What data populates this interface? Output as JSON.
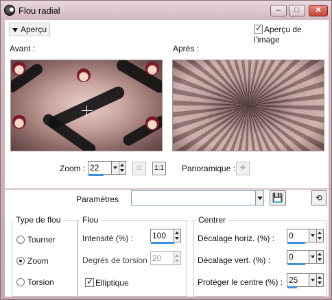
{
  "window": {
    "title": "Flou radial",
    "minimize": "–",
    "maximize": "□",
    "close": "✕"
  },
  "top": {
    "apercu_label": "Aperçu",
    "apercu_image_label": "Aperçu de l'image",
    "apercu_image_checked": true
  },
  "preview": {
    "before_label": "Avant :",
    "after_label": "Après :",
    "zoom_label": "Zoom :",
    "zoom_value": "22",
    "zoom_fit_icon": "fit-icon",
    "zoom_actual_label": "1:1",
    "pan_label": "Panoramique :",
    "pan_icon": "move-icon"
  },
  "params": {
    "label": "Paramètres",
    "value": "",
    "save_icon": "floppy-disk-icon",
    "reset_icon": "reset-icon"
  },
  "blur_type": {
    "title": "Type de flou",
    "options": [
      "Tourner",
      "Zoom",
      "Torsion"
    ],
    "selected": "Zoom"
  },
  "flou": {
    "title": "Flou",
    "intensity_label": "Intensité (%) :",
    "intensity_value": "100",
    "torsion_label": "Degrés de torsion :",
    "torsion_value": "20",
    "elliptic_label": "Elliptique",
    "elliptic_checked": true
  },
  "center": {
    "title": "Centrer",
    "horiz_label": "Décalage horiz. (%) :",
    "horiz_value": "0",
    "vert_label": "Décalage vert. (%) :",
    "vert_value": "0",
    "protect_label": "Protéger le centre (%) :",
    "protect_value": "25"
  },
  "colors": {
    "frame": "#c9aeb5",
    "accent": "#3c8fdc"
  }
}
